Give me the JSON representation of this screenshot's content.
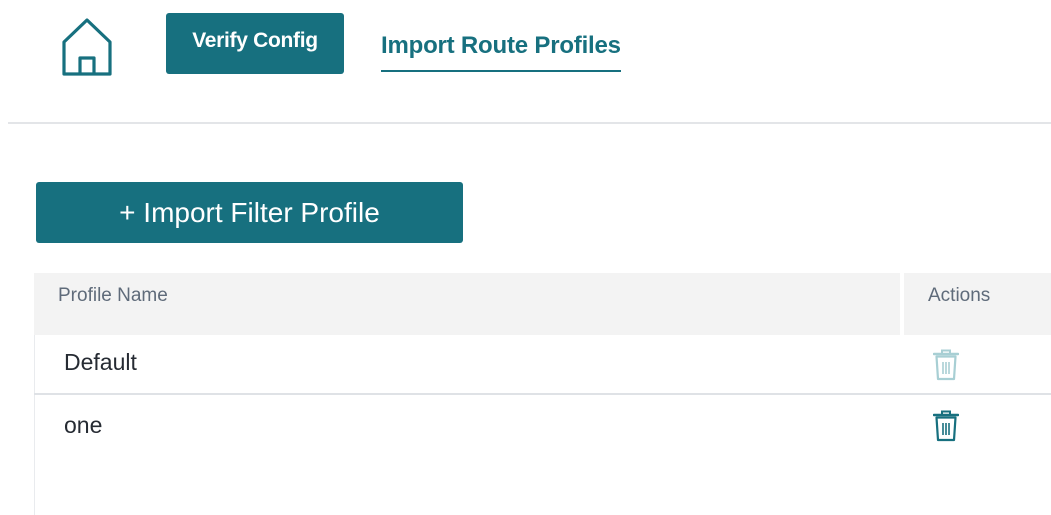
{
  "header": {
    "home_icon": "home-icon",
    "verify_config_label": "Verify Config",
    "active_tab_label": "Import Route Profiles"
  },
  "toolbar": {
    "import_filter_label": "+ Import Filter Profile"
  },
  "table": {
    "columns": [
      "Profile Name",
      "Actions"
    ],
    "rows": [
      {
        "name": "Default",
        "action_icon": "trash-icon",
        "action_state": "disabled"
      },
      {
        "name": "one",
        "action_icon": "trash-icon",
        "action_state": "enabled"
      }
    ]
  },
  "colors": {
    "accent": "#17707f",
    "header_bg": "#f3f3f3",
    "trash_disabled": "#a8cfd4",
    "trash_enabled": "#17707f"
  }
}
